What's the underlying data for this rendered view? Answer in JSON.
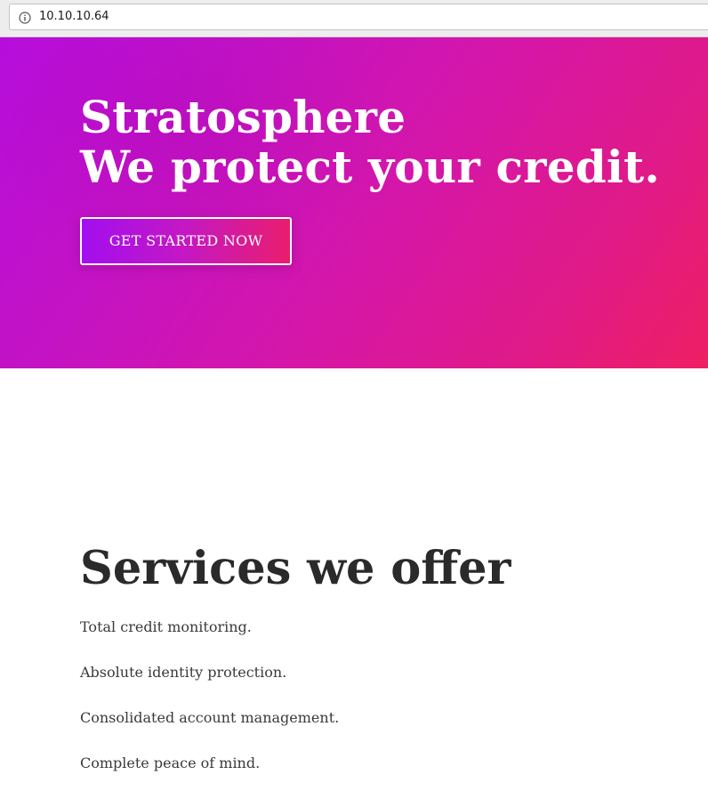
{
  "browser": {
    "url": "10.10.10.64",
    "icon": "info-icon"
  },
  "hero": {
    "title_line1": "Stratosphere",
    "title_line2": "We protect your credit.",
    "cta_label": "GET STARTED NOW",
    "gradient_start": "#b60ddd",
    "gradient_end": "#ee1f63"
  },
  "services": {
    "title": "Services we offer",
    "items": [
      "Total credit monitoring.",
      "Absolute identity protection.",
      "Consolidated account management.",
      "Complete peace of mind."
    ]
  }
}
